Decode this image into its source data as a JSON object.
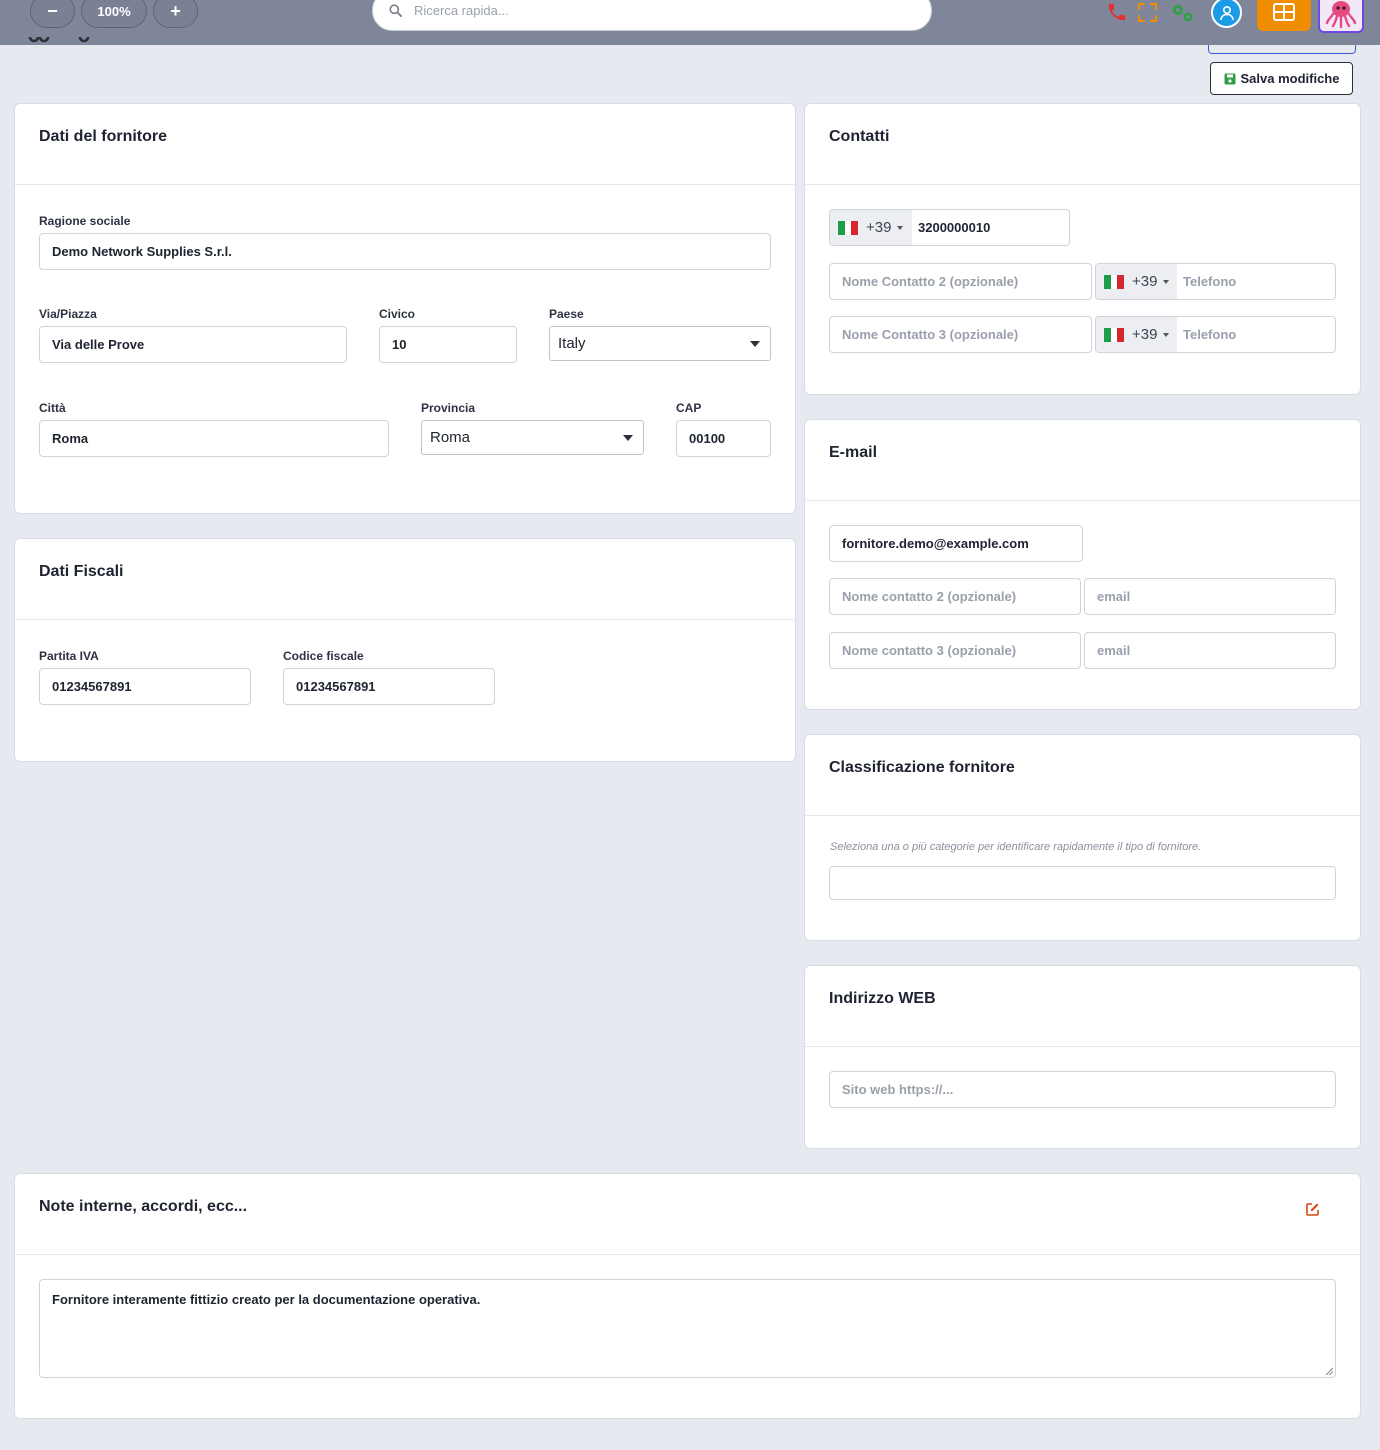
{
  "topbar": {
    "zoom_out": "−",
    "zoom_level": "100%",
    "zoom_in": "+",
    "search_placeholder": "Ricerca rapida..."
  },
  "toolbar": {
    "save_label": "Salva modifiche"
  },
  "supplier": {
    "title": "Dati del fornitore",
    "ragione_label": "Ragione sociale",
    "ragione_value": "Demo Network Supplies S.r.l.",
    "via_label": "Via/Piazza",
    "via_value": "Via delle Prove",
    "civico_label": "Civico",
    "civico_value": "10",
    "paese_label": "Paese",
    "paese_value": "Italy",
    "citta_label": "Città",
    "citta_value": "Roma",
    "provincia_label": "Provincia",
    "provincia_value": "Roma",
    "cap_label": "CAP",
    "cap_value": "00100"
  },
  "fiscal": {
    "title": "Dati Fiscali",
    "piva_label": "Partita IVA",
    "piva_value": "01234567891",
    "cf_label": "Codice fiscale",
    "cf_value": "01234567891"
  },
  "contacts": {
    "title": "Contatti",
    "prefix": "+39",
    "phone1_value": "3200000010",
    "contact2_placeholder": "Nome Contatto 2 (opzionale)",
    "contact3_placeholder": "Nome Contatto 3 (opzionale)",
    "phone_placeholder": "Telefono"
  },
  "email": {
    "title": "E-mail",
    "email1_value": "fornitore.demo@example.com",
    "contact2_placeholder": "Nome contatto 2 (opzionale)",
    "contact3_placeholder": "Nome contatto 3 (opzionale)",
    "email_placeholder": "email"
  },
  "classification": {
    "title": "Classificazione fornitore",
    "hint": "Seleziona una o più categorie per identificare rapidamente il tipo di fornitore."
  },
  "web": {
    "title": "Indirizzo WEB",
    "placeholder": "Sito web https://..."
  },
  "notes": {
    "title": "Note interne, accordi, ecc...",
    "value": "Fornitore interamente fittizio creato per la documentazione operativa."
  },
  "colors": {
    "topbar": "#7f8699",
    "phone_red": "#e03131",
    "expand_orange": "#f08c00",
    "gear_green": "#2f9e44",
    "user_blue": "#228be6",
    "grid_orange": "#f08c00",
    "avatar_pink": "#e64980",
    "save_icon_green": "#2f9e44",
    "edit_icon_orange": "#d9480f"
  },
  "icons": [
    "search-icon",
    "phone-icon",
    "fullscreen-icon",
    "gears-icon",
    "user-icon",
    "grid-icon",
    "octopus-avatar",
    "save-icon",
    "edit-icon",
    "italy-flag-icon"
  ]
}
